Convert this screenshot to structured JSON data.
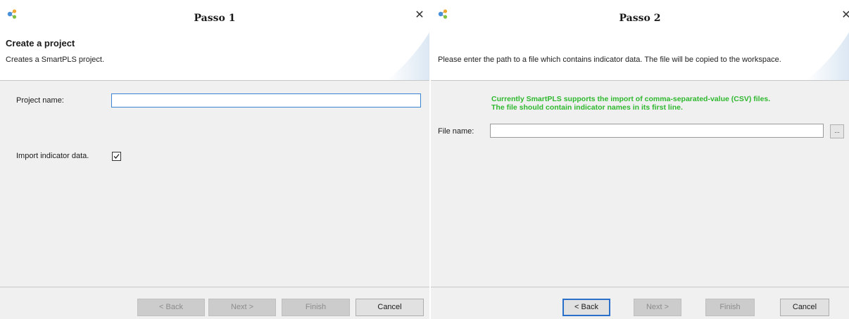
{
  "dialog1": {
    "title": "Passo 1",
    "header_title": "Create a project",
    "header_desc": "Creates a SmartPLS project.",
    "project_name_label": "Project name:",
    "project_name_value": "",
    "import_label": "Import indicator data.",
    "import_checked": true,
    "buttons": {
      "back": "< Back",
      "next": "Next >",
      "finish": "Finish",
      "cancel": "Cancel"
    },
    "close_glyph": "✕"
  },
  "dialog2": {
    "title": "Passo 2",
    "header_desc": "Please enter the path to a file which contains indicator data. The file will be copied to the workspace.",
    "info_line1": "Currently SmartPLS supports the import of comma-separated-value (CSV) files.",
    "info_line2": "The file should contain indicator names in its first line.",
    "file_name_label": "File name:",
    "file_name_value": "",
    "browse_label": "...",
    "buttons": {
      "back": "< Back",
      "next": "Next >",
      "finish": "Finish",
      "cancel": "Cancel"
    },
    "close_glyph": "✕"
  },
  "icons": {
    "app": "smartpls-app-icon",
    "close": "close-icon",
    "check": "checkmark-icon"
  },
  "colors": {
    "info_text": "#2eb82e",
    "focus_border": "#2a6fc9",
    "body_bg": "#f0f0f0"
  }
}
